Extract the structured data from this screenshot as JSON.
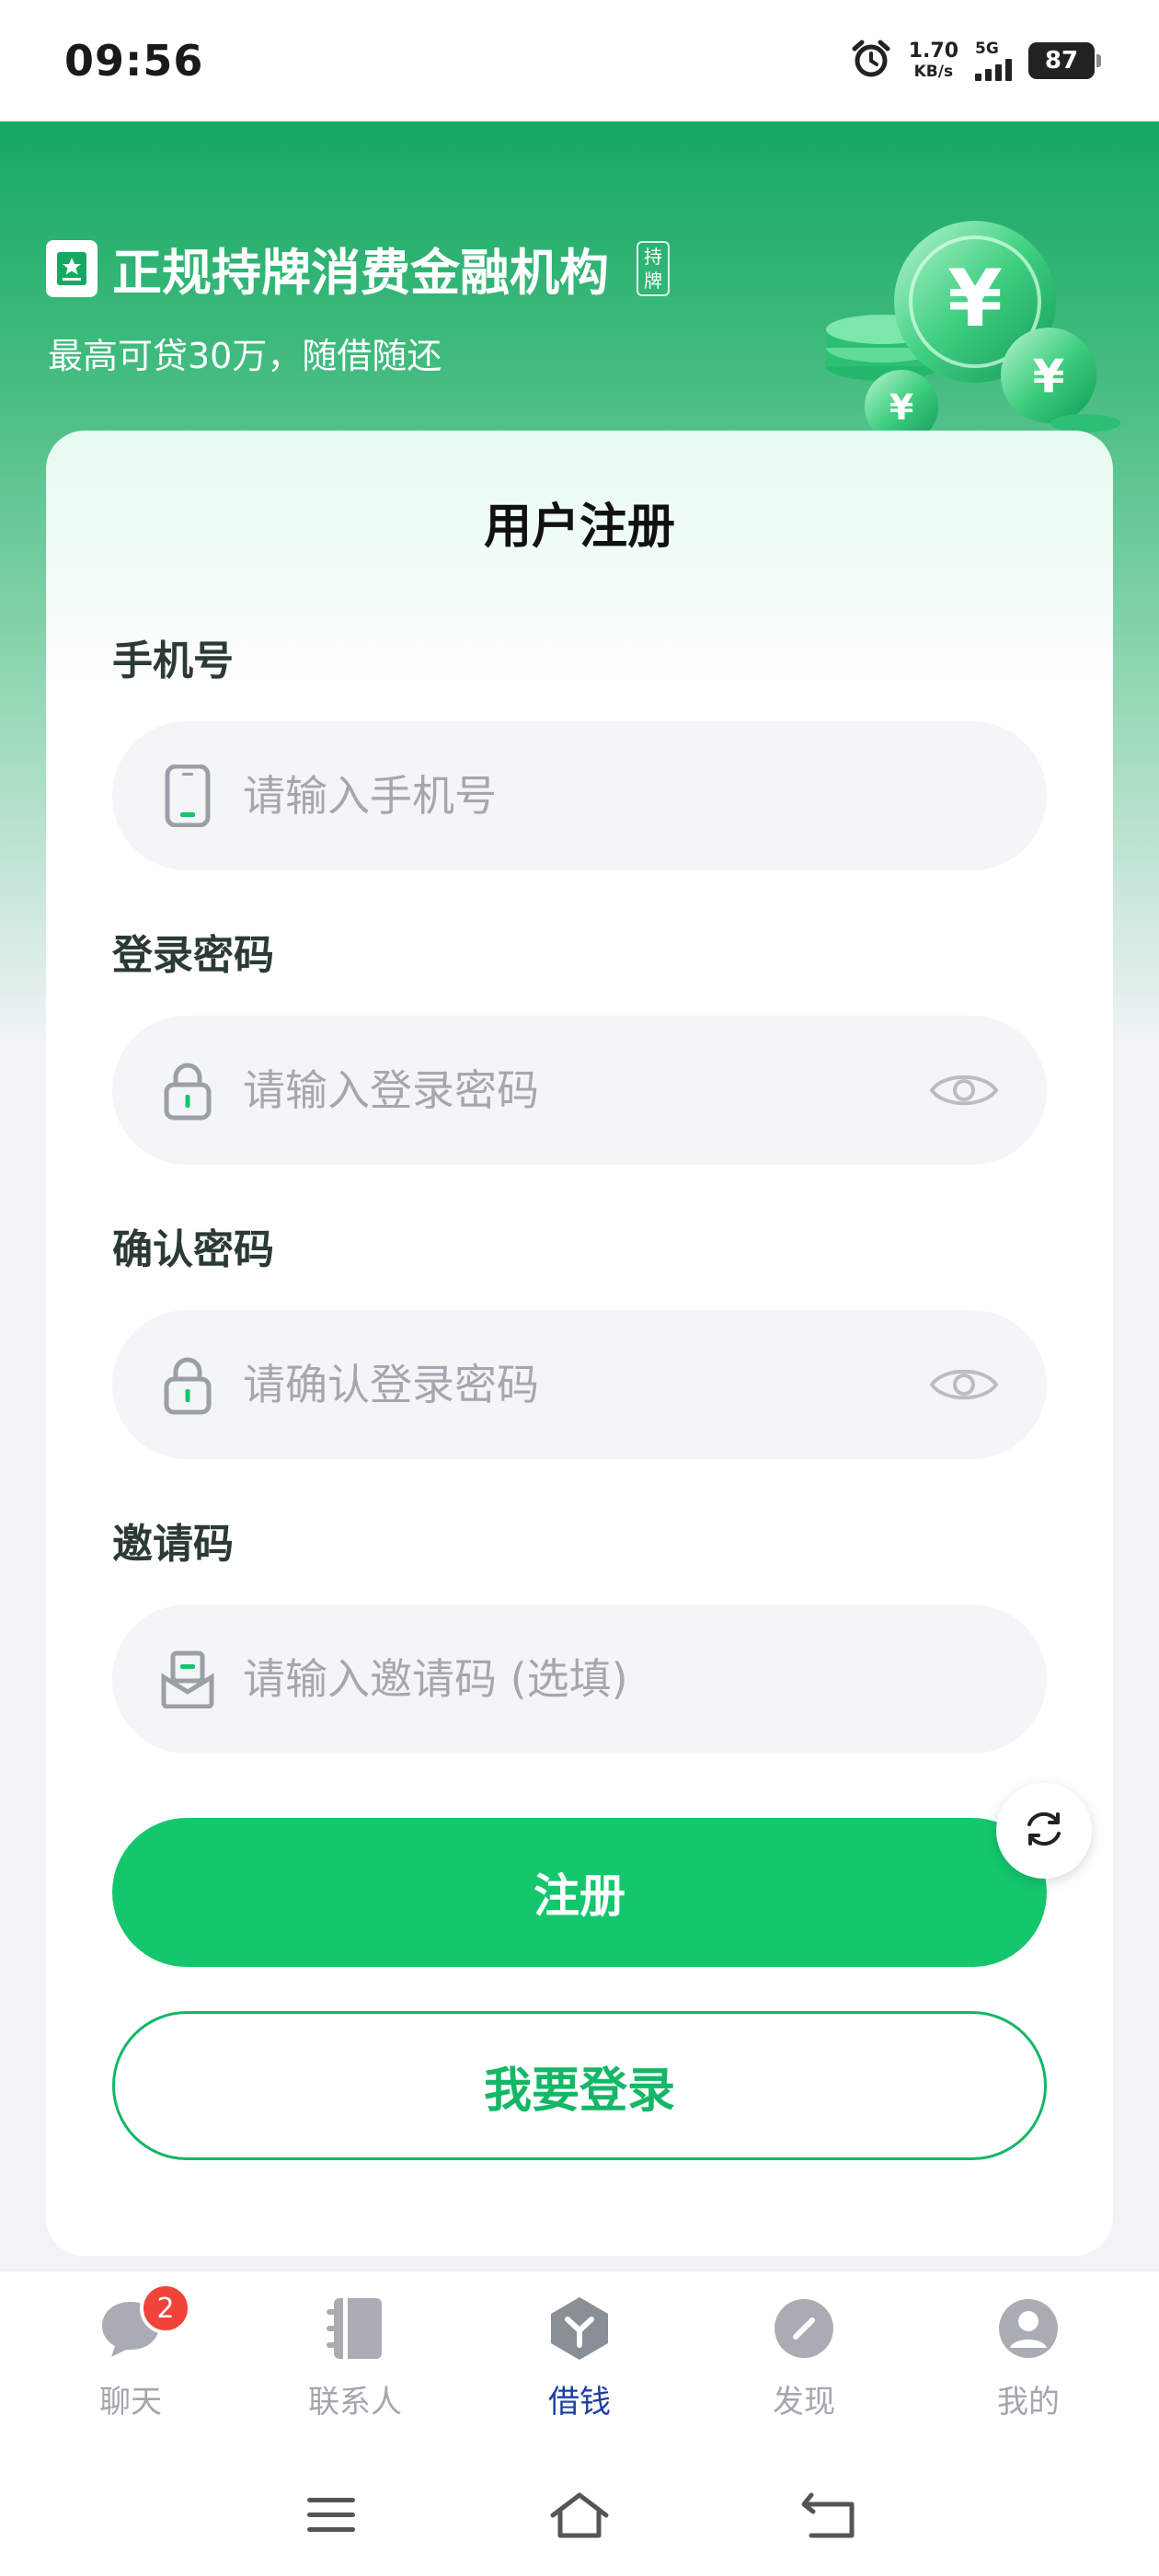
{
  "status_bar": {
    "time": "09:56",
    "net_speed_value": "1.70",
    "net_speed_unit": "KB/s",
    "network": "5G",
    "battery": "87"
  },
  "hero": {
    "title": "正规持牌消费金融机构",
    "license_tag": "持牌",
    "subtitle": "最高可贷30万，随借随还"
  },
  "form": {
    "title": "用户注册",
    "phone": {
      "label": "手机号",
      "placeholder": "请输入手机号"
    },
    "password": {
      "label": "登录密码",
      "placeholder": "请输入登录密码"
    },
    "confirm_password": {
      "label": "确认密码",
      "placeholder": "请确认登录密码"
    },
    "invite_code": {
      "label": "邀请码",
      "placeholder": "请输入邀请码 (选填)"
    },
    "register_label": "注册",
    "login_label": "我要登录"
  },
  "bottom_nav": {
    "items": [
      {
        "label": "聊天",
        "badge": "2",
        "icon": "chat-icon"
      },
      {
        "label": "联系人",
        "icon": "contacts-icon"
      },
      {
        "label": "借钱",
        "icon": "loan-icon",
        "active": true
      },
      {
        "label": "发现",
        "icon": "discover-icon"
      },
      {
        "label": "我的",
        "icon": "profile-icon"
      }
    ]
  },
  "colors": {
    "brand_green": "#14c76c",
    "active_nav": "#1a3fa0",
    "badge_red": "#f0433a"
  }
}
